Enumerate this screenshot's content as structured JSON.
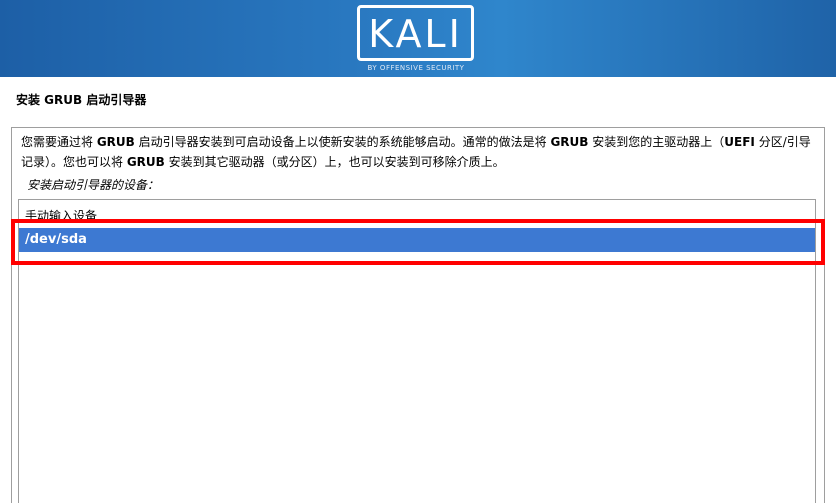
{
  "banner": {
    "logo_text": "KALI",
    "logo_subtitle": "BY OFFENSIVE SECURITY",
    "background_color": "#2a7ac2"
  },
  "page": {
    "title": "安装 GRUB 启动引导器",
    "description_parts": [
      "您需要通过将 ",
      "GRUB",
      " 启动引导器安装到可启动设备上以使新安装的系统能够启动。通常的做法是将 ",
      "GRUB",
      " 安装到您的主驱动器上（",
      "UEFI",
      " 分区/引导记录）。您也可以将 ",
      "GRUB",
      " 安装到其它驱动器（或分区）上，也可以安装到可移除介质上。"
    ],
    "prompt": "安装启动引导器的设备："
  },
  "device_list": {
    "items": [
      "手动输入设备",
      "/dev/sda"
    ],
    "selected": "/dev/sda",
    "selected_color": "#3d79d2"
  },
  "annotation": {
    "highlight_color": "#ff0000"
  }
}
